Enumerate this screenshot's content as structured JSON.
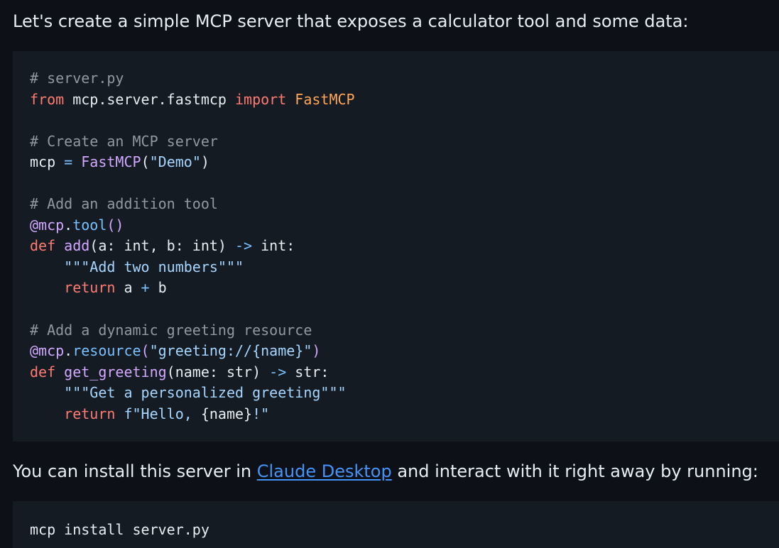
{
  "intro_text": "Let's create a simple MCP server that exposes a calculator tool and some data:",
  "code_lines": [
    [
      {
        "t": "# server.py",
        "c": "c"
      }
    ],
    [
      {
        "t": "from",
        "c": "k"
      },
      {
        "t": " mcp.server.fastmcp ",
        "c": ""
      },
      {
        "t": "import",
        "c": "k"
      },
      {
        "t": " ",
        "c": ""
      },
      {
        "t": "FastMCP",
        "c": "cl"
      }
    ],
    [],
    [
      {
        "t": "# Create an MCP server",
        "c": "c"
      }
    ],
    [
      {
        "t": "mcp ",
        "c": ""
      },
      {
        "t": "=",
        "c": "o"
      },
      {
        "t": " ",
        "c": ""
      },
      {
        "t": "FastMCP",
        "c": "f"
      },
      {
        "t": "(",
        "c": ""
      },
      {
        "t": "\"Demo\"",
        "c": "s"
      },
      {
        "t": ")",
        "c": ""
      }
    ],
    [],
    [
      {
        "t": "# Add an addition tool",
        "c": "c"
      }
    ],
    [
      {
        "t": "@mcp",
        "c": "f"
      },
      {
        "t": ".",
        "c": ""
      },
      {
        "t": "tool",
        "c": "o"
      },
      {
        "t": "()",
        "c": "f"
      }
    ],
    [
      {
        "t": "def",
        "c": "k"
      },
      {
        "t": " ",
        "c": ""
      },
      {
        "t": "add",
        "c": "f"
      },
      {
        "t": "(a: int, b: int) ",
        "c": ""
      },
      {
        "t": "->",
        "c": "o"
      },
      {
        "t": " int:",
        "c": ""
      }
    ],
    [
      {
        "t": "    ",
        "c": ""
      },
      {
        "t": "\"\"\"Add two numbers\"\"\"",
        "c": "s"
      }
    ],
    [
      {
        "t": "    ",
        "c": ""
      },
      {
        "t": "return",
        "c": "k"
      },
      {
        "t": " a ",
        "c": ""
      },
      {
        "t": "+",
        "c": "o"
      },
      {
        "t": " b",
        "c": ""
      }
    ],
    [],
    [
      {
        "t": "# Add a dynamic greeting resource",
        "c": "c"
      }
    ],
    [
      {
        "t": "@mcp",
        "c": "f"
      },
      {
        "t": ".",
        "c": ""
      },
      {
        "t": "resource",
        "c": "o"
      },
      {
        "t": "(",
        "c": "f"
      },
      {
        "t": "\"greeting://{name}\"",
        "c": "s"
      },
      {
        "t": ")",
        "c": "f"
      }
    ],
    [
      {
        "t": "def",
        "c": "k"
      },
      {
        "t": " ",
        "c": ""
      },
      {
        "t": "get_greeting",
        "c": "f"
      },
      {
        "t": "(name: str) ",
        "c": ""
      },
      {
        "t": "->",
        "c": "o"
      },
      {
        "t": " str:",
        "c": ""
      }
    ],
    [
      {
        "t": "    ",
        "c": ""
      },
      {
        "t": "\"\"\"Get a personalized greeting\"\"\"",
        "c": "s"
      }
    ],
    [
      {
        "t": "    ",
        "c": ""
      },
      {
        "t": "return",
        "c": "k"
      },
      {
        "t": " ",
        "c": ""
      },
      {
        "t": "f\"Hello, ",
        "c": "s"
      },
      {
        "t": "{name}",
        "c": ""
      },
      {
        "t": "!\"",
        "c": "s"
      }
    ]
  ],
  "install_text_before": "You can install this server in ",
  "install_link_text": "Claude Desktop",
  "install_text_after": " and interact with it right away by running:",
  "command_text": "mcp install server.py"
}
